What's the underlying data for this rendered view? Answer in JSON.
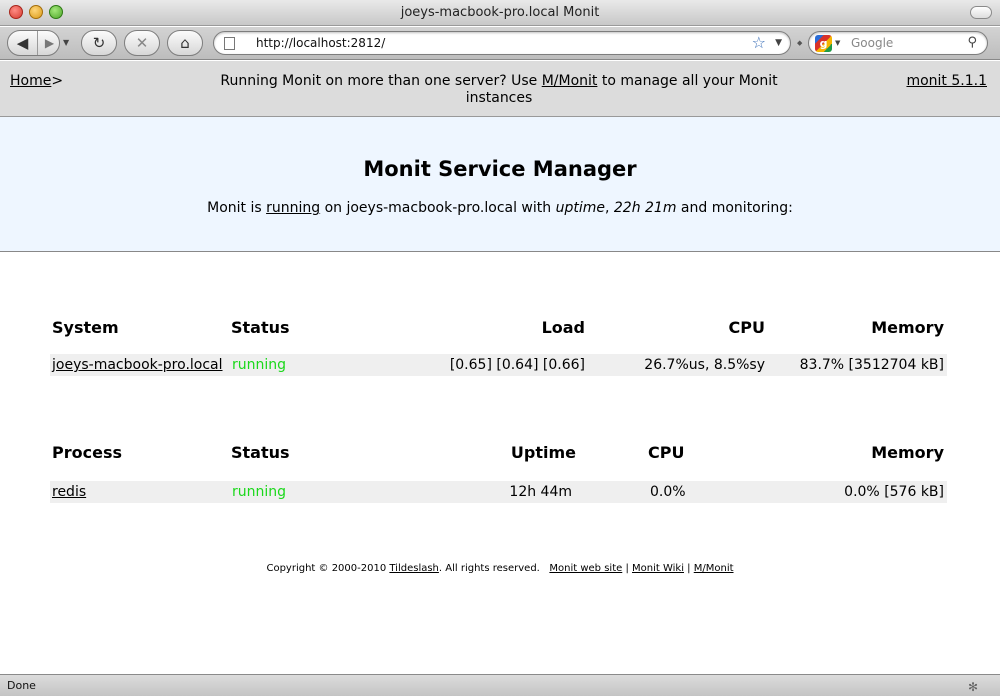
{
  "window": {
    "title": "joeys-macbook-pro.local Monit"
  },
  "toolbar": {
    "url": "http://localhost:2812/",
    "search_placeholder": "Google"
  },
  "header": {
    "home_label": "Home",
    "home_sep": ">",
    "message_prefix": "Running Monit on more than one server? Use ",
    "message_link": "M/Monit",
    "message_suffix": " to manage all your Monit instances",
    "version_label": "monit 5.1.1"
  },
  "banner": {
    "title": "Monit Service Manager",
    "line_prefix": "Monit is ",
    "line_state": "running",
    "line_mid": " on joeys-macbook-pro.local with ",
    "line_uptime_label": "uptime",
    "line_comma": ", ",
    "line_uptime_value": "22h 21m",
    "line_suffix": "  and monitoring:"
  },
  "system_table": {
    "headers": {
      "name": "System",
      "status": "Status",
      "load": "Load",
      "cpu": "CPU",
      "memory": "Memory"
    },
    "rows": [
      {
        "name": "joeys-macbook-pro.local",
        "status": "running",
        "load": "[0.65] [0.64] [0.66]",
        "cpu": "26.7%us, 8.5%sy",
        "memory": "83.7% [3512704 kB]"
      }
    ]
  },
  "process_table": {
    "headers": {
      "name": "Process",
      "status": "Status",
      "uptime": "Uptime",
      "cpu": "CPU",
      "memory": "Memory"
    },
    "rows": [
      {
        "name": "redis",
        "status": "running",
        "uptime": "12h 44m",
        "cpu": "0.0%",
        "memory": "0.0% [576 kB]"
      }
    ]
  },
  "footer": {
    "copyright": "Copyright © 2000-2010 ",
    "company": "Tildeslash",
    "rights": ". All rights reserved.",
    "link_site": "Monit web site",
    "link_wiki": "Monit Wiki",
    "link_mmonit": "M/Monit",
    "separator": " | "
  },
  "statusbar": {
    "text": "Done"
  },
  "colors": {
    "running": "#1bd81b",
    "banner_bg": "#eef6ff",
    "header_bg": "#dcdcdc"
  }
}
